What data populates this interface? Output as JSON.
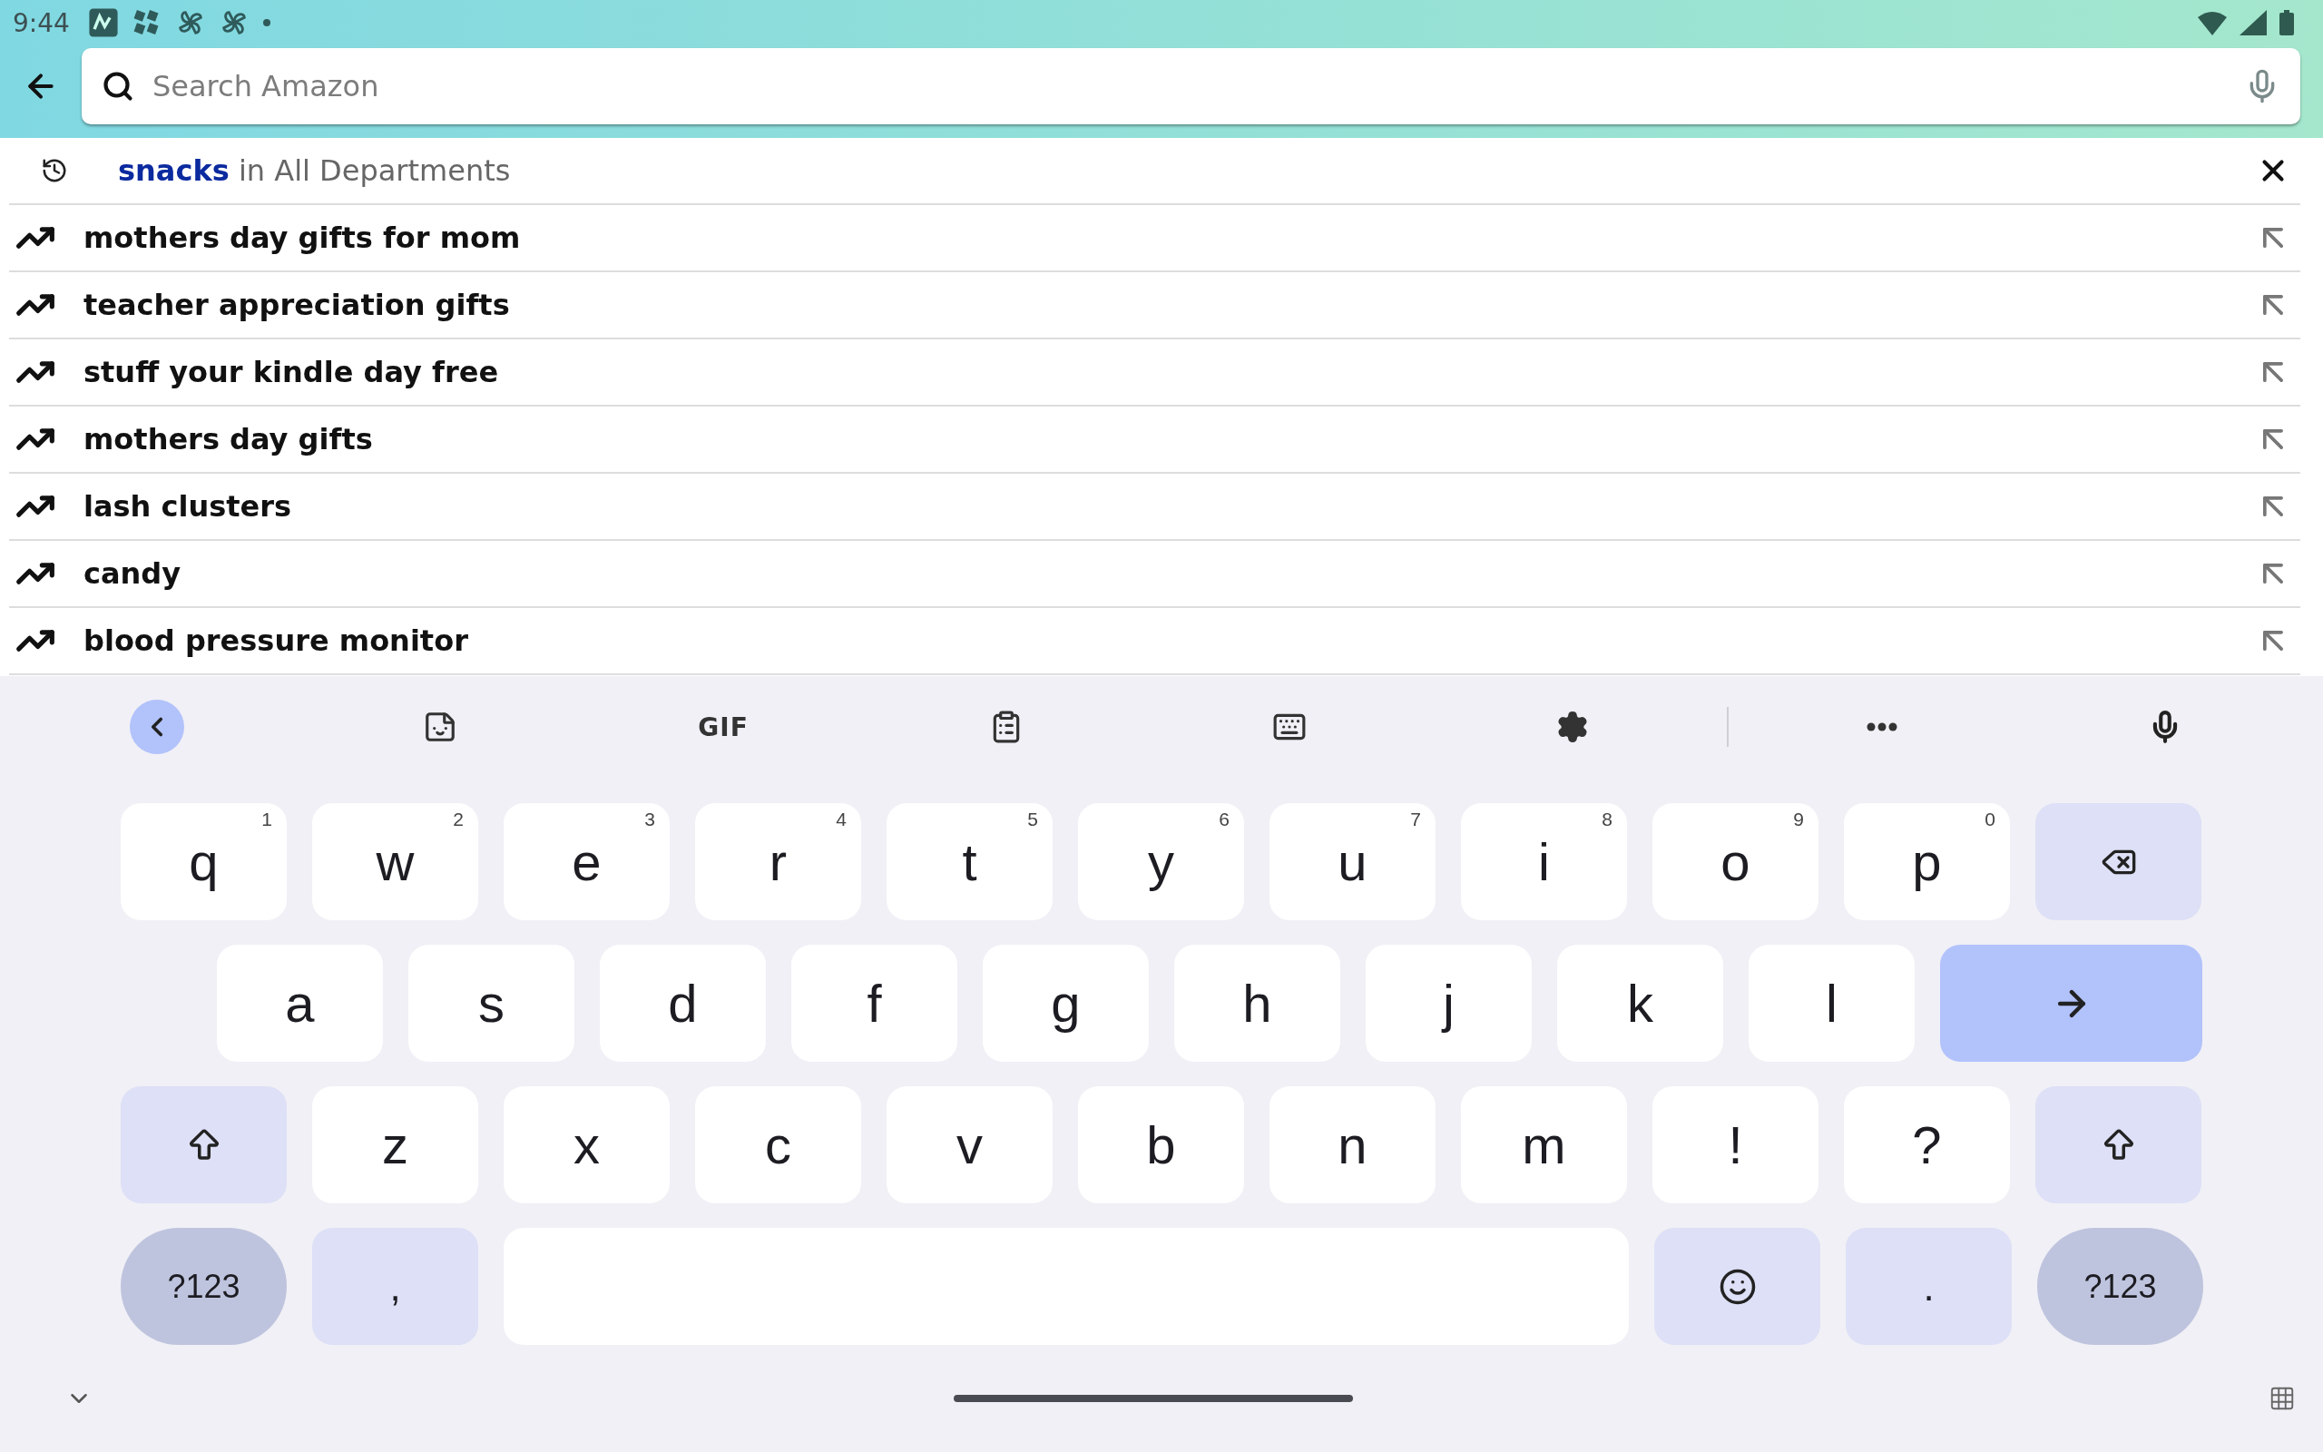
{
  "status_bar": {
    "time": "9:44"
  },
  "search": {
    "placeholder": "Search Amazon"
  },
  "suggestions": [
    {
      "kind": "history",
      "text": "**snacks** in All Departments"
    },
    {
      "kind": "trending",
      "text": "mothers day gifts for mom"
    },
    {
      "kind": "trending",
      "text": "teacher appreciation gifts"
    },
    {
      "kind": "trending",
      "text": "stuff your kindle day free"
    },
    {
      "kind": "trending",
      "text": "mothers day gifts"
    },
    {
      "kind": "trending",
      "text": "lash clusters"
    },
    {
      "kind": "trending",
      "text": "candy"
    },
    {
      "kind": "trending",
      "text": "blood pressure monitor"
    }
  ],
  "keyboard_toolbar": [
    {
      "kind": "back"
    },
    {
      "kind": "sticker"
    },
    {
      "kind": "gif",
      "label": "GIF"
    },
    {
      "kind": "clipboard"
    },
    {
      "kind": "keyboard"
    },
    {
      "kind": "settings"
    },
    {
      "kind": "divider"
    },
    {
      "kind": "more"
    },
    {
      "kind": "mic"
    }
  ],
  "keyboard_rows": [
    [
      {
        "kind": "letter",
        "label": "q",
        "hint": "1"
      },
      {
        "kind": "letter",
        "label": "w",
        "hint": "2"
      },
      {
        "kind": "letter",
        "label": "e",
        "hint": "3"
      },
      {
        "kind": "letter",
        "label": "r",
        "hint": "4"
      },
      {
        "kind": "letter",
        "label": "t",
        "hint": "5"
      },
      {
        "kind": "letter",
        "label": "y",
        "hint": "6"
      },
      {
        "kind": "letter",
        "label": "u",
        "hint": "7"
      },
      {
        "kind": "letter",
        "label": "i",
        "hint": "8"
      },
      {
        "kind": "letter",
        "label": "o",
        "hint": "9"
      },
      {
        "kind": "letter",
        "label": "p",
        "hint": "0"
      },
      {
        "kind": "backspace"
      }
    ],
    [
      {
        "kind": "letter",
        "label": "a"
      },
      {
        "kind": "letter",
        "label": "s"
      },
      {
        "kind": "letter",
        "label": "d"
      },
      {
        "kind": "letter",
        "label": "f"
      },
      {
        "kind": "letter",
        "label": "g"
      },
      {
        "kind": "letter",
        "label": "h"
      },
      {
        "kind": "letter",
        "label": "j"
      },
      {
        "kind": "letter",
        "label": "k"
      },
      {
        "kind": "letter",
        "label": "l"
      },
      {
        "kind": "enter"
      }
    ],
    [
      {
        "kind": "shift"
      },
      {
        "kind": "letter",
        "label": "z"
      },
      {
        "kind": "letter",
        "label": "x"
      },
      {
        "kind": "letter",
        "label": "c"
      },
      {
        "kind": "letter",
        "label": "v"
      },
      {
        "kind": "letter",
        "label": "b"
      },
      {
        "kind": "letter",
        "label": "n"
      },
      {
        "kind": "letter",
        "label": "m"
      },
      {
        "kind": "letter",
        "label": "!"
      },
      {
        "kind": "letter",
        "label": "?"
      },
      {
        "kind": "shift"
      }
    ],
    [
      {
        "kind": "symbols",
        "label": "?123"
      },
      {
        "kind": "punct",
        "label": ","
      },
      {
        "kind": "space"
      },
      {
        "kind": "emoji"
      },
      {
        "kind": "punct",
        "label": "."
      },
      {
        "kind": "symbols",
        "label": "?123"
      }
    ]
  ]
}
